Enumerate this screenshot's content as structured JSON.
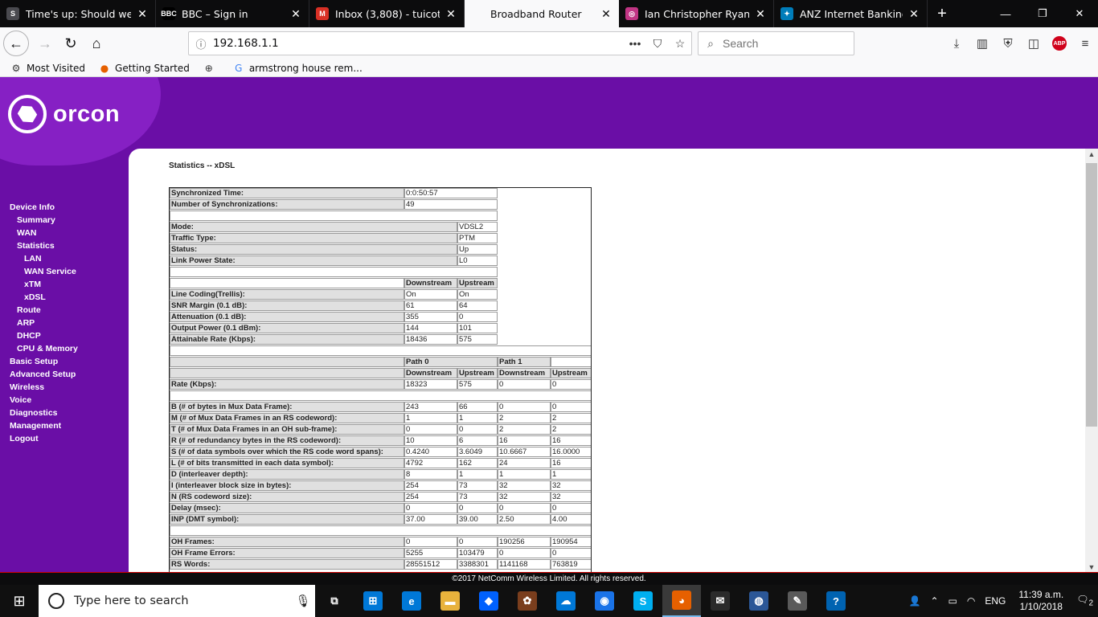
{
  "browser": {
    "tabs": [
      {
        "title": "Time's up: Should we end",
        "favicon_text": "S",
        "favicon_color": "#4a4a4f",
        "active": false
      },
      {
        "title": "BBC – Sign in",
        "favicon_text": "BBC",
        "favicon_color": "#000000",
        "active": false
      },
      {
        "title": "Inbox (3,808) - tuicottage",
        "favicon_text": "M",
        "favicon_color": "#d93025",
        "active": false
      },
      {
        "title": "Broadband Router",
        "favicon_text": "",
        "favicon_color": "#f9f9fa",
        "active": true
      },
      {
        "title": "Ian Christopher Ryan (@",
        "favicon_text": "◎",
        "favicon_color": "#c13584",
        "active": false
      },
      {
        "title": "ANZ Internet Banking",
        "favicon_text": "✦",
        "favicon_color": "#007dba",
        "active": false
      }
    ],
    "url": "192.168.1.1",
    "search_placeholder": "Search",
    "bookmarks": [
      {
        "label": "Most Visited",
        "icon": "gear-icon"
      },
      {
        "label": "Getting Started",
        "icon": "firefox-icon"
      },
      {
        "label": "",
        "icon": "globe-icon"
      },
      {
        "label": "armstrong house rem...",
        "icon": "google-icon"
      }
    ],
    "abp_label": "ABP"
  },
  "router": {
    "brand": "orcon",
    "page_title": "Statistics -- xDSL",
    "footer": "©2017 NetComm Wireless Limited. All rights reserved.",
    "menu": [
      {
        "label": "Device Info",
        "level": 1
      },
      {
        "label": "Summary",
        "level": 2
      },
      {
        "label": "WAN",
        "level": 2
      },
      {
        "label": "Statistics",
        "level": 2
      },
      {
        "label": "LAN",
        "level": 3
      },
      {
        "label": "WAN Service",
        "level": 3
      },
      {
        "label": "xTM",
        "level": 3
      },
      {
        "label": "xDSL",
        "level": 3
      },
      {
        "label": "Route",
        "level": 2
      },
      {
        "label": "ARP",
        "level": 2
      },
      {
        "label": "DHCP",
        "level": 2
      },
      {
        "label": "CPU & Memory",
        "level": 2
      },
      {
        "label": "Basic Setup",
        "level": 1
      },
      {
        "label": "Advanced Setup",
        "level": 1
      },
      {
        "label": "Wireless",
        "level": 1
      },
      {
        "label": "Voice",
        "level": 1
      },
      {
        "label": "Diagnostics",
        "level": 1
      },
      {
        "label": "Management",
        "level": 1
      },
      {
        "label": "Logout",
        "level": 1
      }
    ],
    "sync": [
      {
        "label": "Synchronized Time:",
        "value": "0:0:50:57"
      },
      {
        "label": "Number of Synchronizations:",
        "value": "49"
      }
    ],
    "mode": [
      {
        "label": "Mode:",
        "value": "VDSL2"
      },
      {
        "label": "Traffic Type:",
        "value": "PTM"
      },
      {
        "label": "Status:",
        "value": "Up"
      },
      {
        "label": "Link Power State:",
        "value": "L0"
      }
    ],
    "line_headers": [
      "Downstream",
      "Upstream"
    ],
    "line": [
      {
        "label": "Line Coding(Trellis):",
        "down": "On",
        "up": "On"
      },
      {
        "label": "SNR Margin (0.1 dB):",
        "down": "61",
        "up": "64"
      },
      {
        "label": "Attenuation (0.1 dB):",
        "down": "355",
        "up": "0"
      },
      {
        "label": "Output Power (0.1 dBm):",
        "down": "144",
        "up": "101"
      },
      {
        "label": "Attainable Rate (Kbps):",
        "down": "18436",
        "up": "575"
      }
    ],
    "path_headers": [
      "Path 0",
      "Path 1"
    ],
    "path_sub_headers": [
      "Downstream",
      "Upstream",
      "Downstream",
      "Upstream"
    ],
    "rate": {
      "label": "Rate (Kbps):",
      "values": [
        "18323",
        "575",
        "0",
        "0"
      ]
    },
    "frame": [
      {
        "label": "B (# of bytes in Mux Data Frame):",
        "values": [
          "243",
          "66",
          "0",
          "0"
        ]
      },
      {
        "label": "M (# of Mux Data Frames in an RS codeword):",
        "values": [
          "1",
          "1",
          "2",
          "2"
        ]
      },
      {
        "label": "T (# of Mux Data Frames in an OH sub-frame):",
        "values": [
          "0",
          "0",
          "2",
          "2"
        ]
      },
      {
        "label": "R (# of redundancy bytes in the RS codeword):",
        "values": [
          "10",
          "6",
          "16",
          "16"
        ]
      },
      {
        "label": "S (# of data symbols over which the RS code word spans):",
        "values": [
          "0.4240",
          "3.6049",
          "10.6667",
          "16.0000"
        ]
      },
      {
        "label": "L (# of bits transmitted in each data symbol):",
        "values": [
          "4792",
          "162",
          "24",
          "16"
        ]
      },
      {
        "label": "D (interleaver depth):",
        "values": [
          "8",
          "1",
          "1",
          "1"
        ]
      },
      {
        "label": "I (interleaver block size in bytes):",
        "values": [
          "254",
          "73",
          "32",
          "32"
        ]
      },
      {
        "label": "N (RS codeword size):",
        "values": [
          "254",
          "73",
          "32",
          "32"
        ]
      },
      {
        "label": "Delay (msec):",
        "values": [
          "0",
          "0",
          "0",
          "0"
        ]
      },
      {
        "label": "INP (DMT symbol):",
        "values": [
          "37.00",
          "39.00",
          "2.50",
          "4.00"
        ]
      }
    ],
    "oh": [
      {
        "label": "OH Frames:",
        "values": [
          "0",
          "0",
          "190256",
          "190954"
        ]
      },
      {
        "label": "OH Frame Errors:",
        "values": [
          "5255",
          "103479",
          "0",
          "0"
        ]
      },
      {
        "label": "RS Words:",
        "values": [
          "28551512",
          "3388301",
          "1141168",
          "763819"
        ]
      }
    ]
  },
  "taskbar": {
    "search_placeholder": "Type here to search",
    "language": "ENG",
    "time": "11:39 a.m.",
    "date": "1/10/2018",
    "notification_count": "2",
    "apps": [
      {
        "name": "task-view-icon",
        "glyph": "⧉",
        "color": "#101010"
      },
      {
        "name": "store-icon",
        "glyph": "⊞",
        "color": "#0078d7"
      },
      {
        "name": "edge-icon",
        "glyph": "e",
        "color": "#0078d7"
      },
      {
        "name": "file-explorer-icon",
        "glyph": "▬",
        "color": "#e8b23c"
      },
      {
        "name": "dropbox-icon",
        "glyph": "◆",
        "color": "#0061fe"
      },
      {
        "name": "paint-icon",
        "glyph": "✿",
        "color": "#7a3e1d"
      },
      {
        "name": "onedrive-icon",
        "glyph": "☁",
        "color": "#0078d7"
      },
      {
        "name": "chrome-icon",
        "glyph": "◉",
        "color": "#1a73e8"
      },
      {
        "name": "skype-icon",
        "glyph": "S",
        "color": "#00aff0"
      },
      {
        "name": "firefox-icon",
        "glyph": "◕",
        "color": "#e66000"
      },
      {
        "name": "mail-icon",
        "glyph": "✉",
        "color": "#2b2b2b"
      },
      {
        "name": "network-globe-icon",
        "glyph": "◍",
        "color": "#2b5797"
      },
      {
        "name": "paintbrush-icon",
        "glyph": "✎",
        "color": "#5a5a5a"
      },
      {
        "name": "help-icon",
        "glyph": "?",
        "color": "#0063b1"
      }
    ]
  }
}
